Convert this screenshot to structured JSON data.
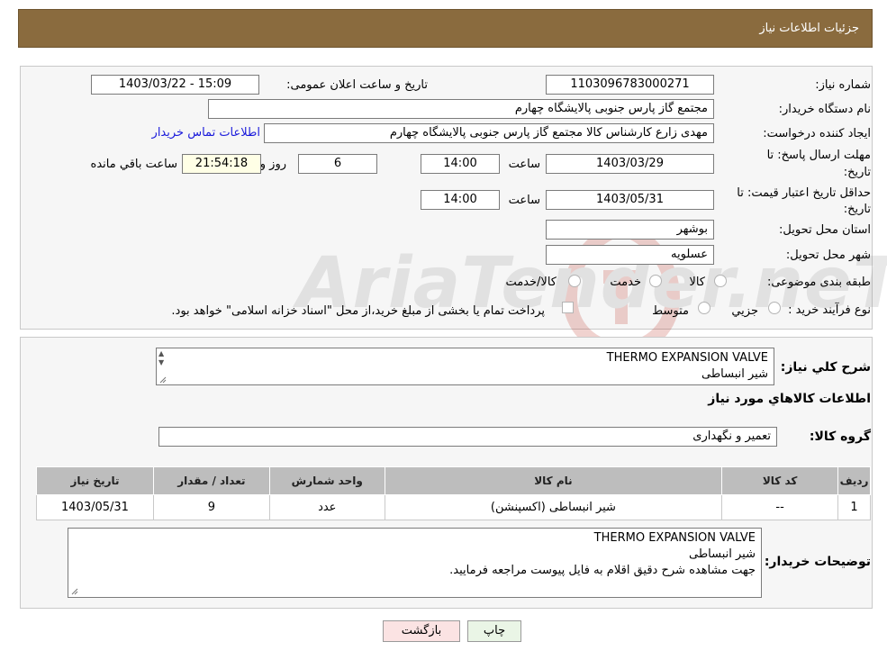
{
  "header": {
    "title": "جزئیات اطلاعات نیاز"
  },
  "form": {
    "need_number_label": "شماره نیاز:",
    "need_number": "1103096783000271",
    "announce_label": "تاریخ و ساعت اعلان عمومی:",
    "announce_value": "1403/03/22 - 15:09",
    "buyer_org_label": "نام دستگاه خریدار:",
    "buyer_org": "مجتمع گاز پارس جنوبی  پالایشگاه چهارم",
    "creator_label": "ایجاد کننده درخواست:",
    "creator": "مهدی زارع کارشناس کالا مجتمع گاز پارس جنوبی  پالایشگاه چهارم",
    "contact_link": "اطلاعات تماس خریدار",
    "reply_deadline_label_1": "مهلت ارسال پاسخ: تا",
    "reply_deadline_label_2": "تاریخ:",
    "reply_date": "1403/03/29",
    "time_label": "ساعت",
    "reply_time": "14:00",
    "days_value": "6",
    "days_label": "روز و",
    "remaining_time": "21:54:18",
    "remaining_label": "ساعت باقي مانده",
    "price_validity_label_1": "حداقل تاریخ اعتبار قیمت: تا",
    "price_validity_label_2": "تاریخ:",
    "price_date": "1403/05/31",
    "price_time": "14:00",
    "province_label": "استان محل تحویل:",
    "province": "بوشهر",
    "city_label": "شهر محل تحویل:",
    "city": "عسلویه",
    "category_label": "طبقه بندی موضوعی:",
    "category_options": [
      "کالا",
      "خدمت",
      "کالا/خدمت"
    ],
    "process_label": "نوع فرآیند خرید :",
    "process_options": [
      "جزیي",
      "متوسط"
    ],
    "payment_note": "پرداخت تمام یا بخشی از مبلغ خرید،از محل \"اسناد خزانه اسلامی\" خواهد بود."
  },
  "watermark": {
    "text": "AriaTender.neT"
  },
  "details": {
    "summary_label": "شرح كلي نياز:",
    "summary_lines": [
      "THERMO EXPANSION VALVE",
      "شیر انبساطی"
    ],
    "items_title": "اطلاعات کالاهاي مورد نياز",
    "group_label": "گروه کالا:",
    "group_value": "تعمیر و نگهداری",
    "table": {
      "headers": [
        "ردیف",
        "کد کالا",
        "نام کالا",
        "واحد شمارش",
        "تعداد / مقدار",
        "تاریخ نیاز"
      ],
      "rows": [
        [
          "1",
          "--",
          "شیر انبساطی (اکسپنشن)",
          "عدد",
          "9",
          "1403/05/31"
        ]
      ]
    },
    "buyer_notes_label": "توضیحات خریدار:",
    "buyer_notes_lines": [
      "THERMO EXPANSION VALVE",
      "شیر انبساطی",
      "جهت مشاهده شرح دقیق اقلام به فایل پیوست مراجعه فرمایید."
    ]
  },
  "buttons": {
    "print": "چاپ",
    "back": "بازگشت"
  },
  "colors": {
    "header_bg": "#8a6b3e",
    "link": "#1a1adb",
    "print_bg": "#eaf5e6",
    "back_bg": "#fbe3e3"
  }
}
